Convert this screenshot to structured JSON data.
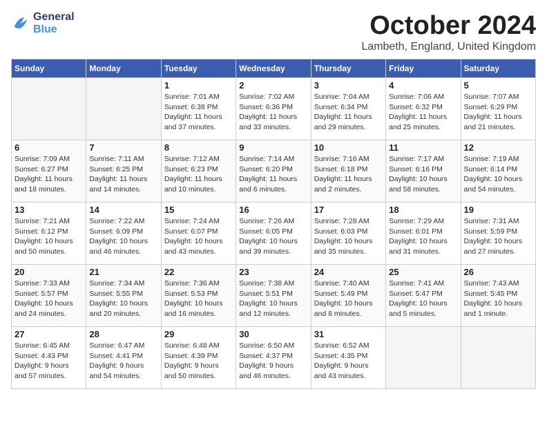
{
  "logo": {
    "line1": "General",
    "line2": "Blue"
  },
  "title": "October 2024",
  "subtitle": "Lambeth, England, United Kingdom",
  "days_of_week": [
    "Sunday",
    "Monday",
    "Tuesday",
    "Wednesday",
    "Thursday",
    "Friday",
    "Saturday"
  ],
  "weeks": [
    [
      {
        "day": "",
        "empty": true
      },
      {
        "day": "",
        "empty": true
      },
      {
        "day": "1",
        "info": "Sunrise: 7:01 AM\nSunset: 6:38 PM\nDaylight: 11 hours\nand 37 minutes."
      },
      {
        "day": "2",
        "info": "Sunrise: 7:02 AM\nSunset: 6:36 PM\nDaylight: 11 hours\nand 33 minutes."
      },
      {
        "day": "3",
        "info": "Sunrise: 7:04 AM\nSunset: 6:34 PM\nDaylight: 11 hours\nand 29 minutes."
      },
      {
        "day": "4",
        "info": "Sunrise: 7:06 AM\nSunset: 6:32 PM\nDaylight: 11 hours\nand 25 minutes."
      },
      {
        "day": "5",
        "info": "Sunrise: 7:07 AM\nSunset: 6:29 PM\nDaylight: 11 hours\nand 21 minutes."
      }
    ],
    [
      {
        "day": "6",
        "info": "Sunrise: 7:09 AM\nSunset: 6:27 PM\nDaylight: 11 hours\nand 18 minutes."
      },
      {
        "day": "7",
        "info": "Sunrise: 7:11 AM\nSunset: 6:25 PM\nDaylight: 11 hours\nand 14 minutes."
      },
      {
        "day": "8",
        "info": "Sunrise: 7:12 AM\nSunset: 6:23 PM\nDaylight: 11 hours\nand 10 minutes."
      },
      {
        "day": "9",
        "info": "Sunrise: 7:14 AM\nSunset: 6:20 PM\nDaylight: 11 hours\nand 6 minutes."
      },
      {
        "day": "10",
        "info": "Sunrise: 7:16 AM\nSunset: 6:18 PM\nDaylight: 11 hours\nand 2 minutes."
      },
      {
        "day": "11",
        "info": "Sunrise: 7:17 AM\nSunset: 6:16 PM\nDaylight: 10 hours\nand 58 minutes."
      },
      {
        "day": "12",
        "info": "Sunrise: 7:19 AM\nSunset: 6:14 PM\nDaylight: 10 hours\nand 54 minutes."
      }
    ],
    [
      {
        "day": "13",
        "info": "Sunrise: 7:21 AM\nSunset: 6:12 PM\nDaylight: 10 hours\nand 50 minutes."
      },
      {
        "day": "14",
        "info": "Sunrise: 7:22 AM\nSunset: 6:09 PM\nDaylight: 10 hours\nand 46 minutes."
      },
      {
        "day": "15",
        "info": "Sunrise: 7:24 AM\nSunset: 6:07 PM\nDaylight: 10 hours\nand 43 minutes."
      },
      {
        "day": "16",
        "info": "Sunrise: 7:26 AM\nSunset: 6:05 PM\nDaylight: 10 hours\nand 39 minutes."
      },
      {
        "day": "17",
        "info": "Sunrise: 7:28 AM\nSunset: 6:03 PM\nDaylight: 10 hours\nand 35 minutes."
      },
      {
        "day": "18",
        "info": "Sunrise: 7:29 AM\nSunset: 6:01 PM\nDaylight: 10 hours\nand 31 minutes."
      },
      {
        "day": "19",
        "info": "Sunrise: 7:31 AM\nSunset: 5:59 PM\nDaylight: 10 hours\nand 27 minutes."
      }
    ],
    [
      {
        "day": "20",
        "info": "Sunrise: 7:33 AM\nSunset: 5:57 PM\nDaylight: 10 hours\nand 24 minutes."
      },
      {
        "day": "21",
        "info": "Sunrise: 7:34 AM\nSunset: 5:55 PM\nDaylight: 10 hours\nand 20 minutes."
      },
      {
        "day": "22",
        "info": "Sunrise: 7:36 AM\nSunset: 5:53 PM\nDaylight: 10 hours\nand 16 minutes."
      },
      {
        "day": "23",
        "info": "Sunrise: 7:38 AM\nSunset: 5:51 PM\nDaylight: 10 hours\nand 12 minutes."
      },
      {
        "day": "24",
        "info": "Sunrise: 7:40 AM\nSunset: 5:49 PM\nDaylight: 10 hours\nand 8 minutes."
      },
      {
        "day": "25",
        "info": "Sunrise: 7:41 AM\nSunset: 5:47 PM\nDaylight: 10 hours\nand 5 minutes."
      },
      {
        "day": "26",
        "info": "Sunrise: 7:43 AM\nSunset: 5:45 PM\nDaylight: 10 hours\nand 1 minute."
      }
    ],
    [
      {
        "day": "27",
        "info": "Sunrise: 6:45 AM\nSunset: 4:43 PM\nDaylight: 9 hours\nand 57 minutes."
      },
      {
        "day": "28",
        "info": "Sunrise: 6:47 AM\nSunset: 4:41 PM\nDaylight: 9 hours\nand 54 minutes."
      },
      {
        "day": "29",
        "info": "Sunrise: 6:48 AM\nSunset: 4:39 PM\nDaylight: 9 hours\nand 50 minutes."
      },
      {
        "day": "30",
        "info": "Sunrise: 6:50 AM\nSunset: 4:37 PM\nDaylight: 9 hours\nand 46 minutes."
      },
      {
        "day": "31",
        "info": "Sunrise: 6:52 AM\nSunset: 4:35 PM\nDaylight: 9 hours\nand 43 minutes."
      },
      {
        "day": "",
        "empty": true
      },
      {
        "day": "",
        "empty": true
      }
    ]
  ]
}
